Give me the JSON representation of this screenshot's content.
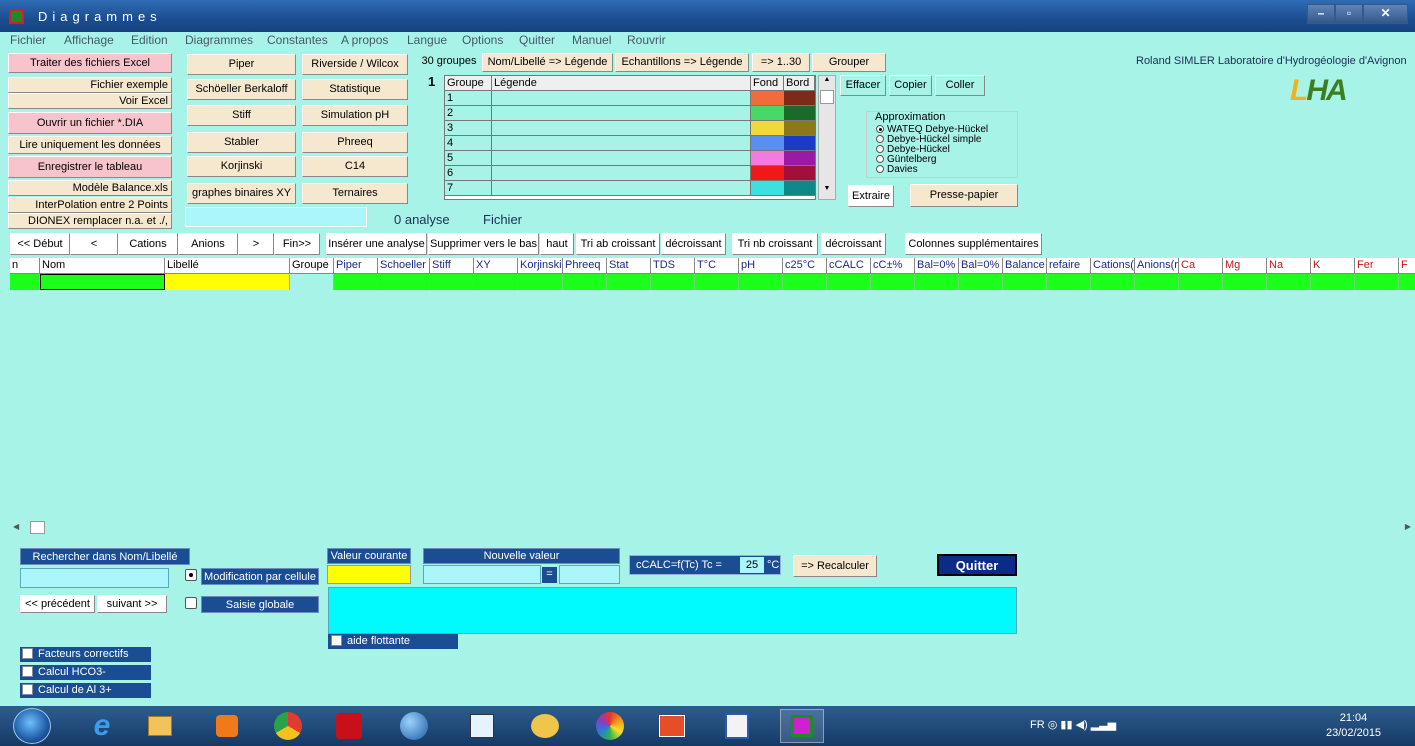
{
  "window": {
    "title": "Diagrammes",
    "minimize": "–",
    "maximize": "▫",
    "close": "✕"
  },
  "menu": [
    "Fichier",
    "Affichage",
    "Edition",
    "Diagrammes",
    "Constantes",
    "A propos",
    "Langue",
    "Options",
    "Quitter",
    "Manuel",
    "Rouvrir"
  ],
  "left_buttons": {
    "traiter": "Traiter des fichiers Excel",
    "fichier_exemple": "Fichier exemple",
    "voir_excel": "Voir Excel",
    "ouvrir": "Ouvrir un fichier *.DIA",
    "lire": "Lire uniquement les données",
    "enregistrer": "Enregistrer le tableau",
    "modele": "Modèle Balance.xls",
    "interpolation": "InterPolation entre 2 Points",
    "dionex": "DIONEX remplacer n.a. et ./,"
  },
  "diagram_buttons": {
    "piper": "Piper",
    "schoeller": "Schöeller Berkaloff",
    "stiff": "Stiff",
    "stabler": "Stabler",
    "korjinski": "Korjinski",
    "binaires": "graphes binaires XY",
    "riverside": "Riverside / Wilcox",
    "statistique": "Statistique",
    "simulation": "Simulation pH",
    "phreeq": "Phreeq",
    "c14": "C14",
    "ternaires": "Ternaires"
  },
  "groups_toolbar": {
    "groupes": "30 groupes",
    "nom_legende": "Nom/Libellé => Légende",
    "ech_legende": "Echantillons => Légende",
    "range": "=> 1..30",
    "grouper": "Grouper",
    "page_num": "1"
  },
  "legend_table": {
    "headers": [
      "Groupe",
      "Légende",
      "Fond",
      "Bord"
    ],
    "rows": [
      {
        "n": "1",
        "fond": "#f26b3a",
        "bord": "#7d2a1a"
      },
      {
        "n": "2",
        "fond": "#47d86a",
        "bord": "#1c6a2a"
      },
      {
        "n": "3",
        "fond": "#f2d93a",
        "bord": "#8c7a1a"
      },
      {
        "n": "4",
        "fond": "#5a8ef2",
        "bord": "#1a3ac8"
      },
      {
        "n": "5",
        "fond": "#f27ae0",
        "bord": "#9a1aa8"
      },
      {
        "n": "6",
        "fond": "#f01818",
        "bord": "#a0103a"
      },
      {
        "n": "7",
        "fond": "#3de0e0",
        "bord": "#108888"
      }
    ]
  },
  "edit_buttons": {
    "effacer": "Effacer",
    "copier": "Copier",
    "coller": "Coller",
    "extraire": "Extraire",
    "presse_papier": "Presse-papier"
  },
  "approximation": {
    "title": "Approximation",
    "options": [
      "WATEQ Debye-Hückel",
      "Debye-Hückel simple",
      "Debye-Hückel",
      "Güntelberg",
      "Davies"
    ],
    "selected": 0
  },
  "credit": "Roland SIMLER Laboratoire d'Hydrogéologie d'Avignon",
  "logo": {
    "a": "L",
    "b": "HA"
  },
  "status": {
    "analyses": "0 analyse",
    "fichier": "Fichier"
  },
  "nav_toolbar": [
    "<< Début",
    "<",
    "Cations",
    "Anions",
    ">",
    "Fin>>",
    "Insérer une analyse",
    "Supprimer vers le bas",
    "haut",
    "Tri ab croissant",
    "décroissant",
    "Tri nb croissant",
    "décroissant",
    "Colonnes supplémentaires"
  ],
  "grid_columns": [
    "n",
    "Nom",
    "Libellé",
    "Groupe",
    "Piper",
    "Schoeller",
    "Stiff",
    "XY",
    "Korjinski",
    "Phreeq",
    "Stat",
    "TDS",
    "T°C",
    "pH",
    "c25°C",
    "cCALC",
    "cC±%",
    "Bal=0%",
    "Bal=0%",
    "Balance",
    "refaire",
    "Cations(",
    "Anions(r",
    "Ca",
    "Mg",
    "Na",
    "K",
    "Fer",
    "F"
  ],
  "bottom": {
    "rechercher": "Rechercher dans Nom/Libellé",
    "precedent": "<< précédent",
    "suivant": "suivant >>",
    "modif_cellule": "Modification par cellule",
    "saisie_globale": "Saisie globale",
    "valeur_courante": "Valeur courante",
    "nouvelle_valeur": "Nouvelle valeur",
    "equals": "=",
    "ccalc": "cCALC=f(Tc)  Tc =",
    "tc_value": "25",
    "unit": "°C",
    "recalculer": "=> Recalculer",
    "quitter": "Quitter",
    "aide": "aide flottante",
    "facteurs": "Facteurs correctifs",
    "hco3": "Calcul HCO3-",
    "al": "Calcul de Al 3+"
  },
  "tray": {
    "lang": "FR",
    "time": "21:04",
    "date": "23/02/2015"
  }
}
